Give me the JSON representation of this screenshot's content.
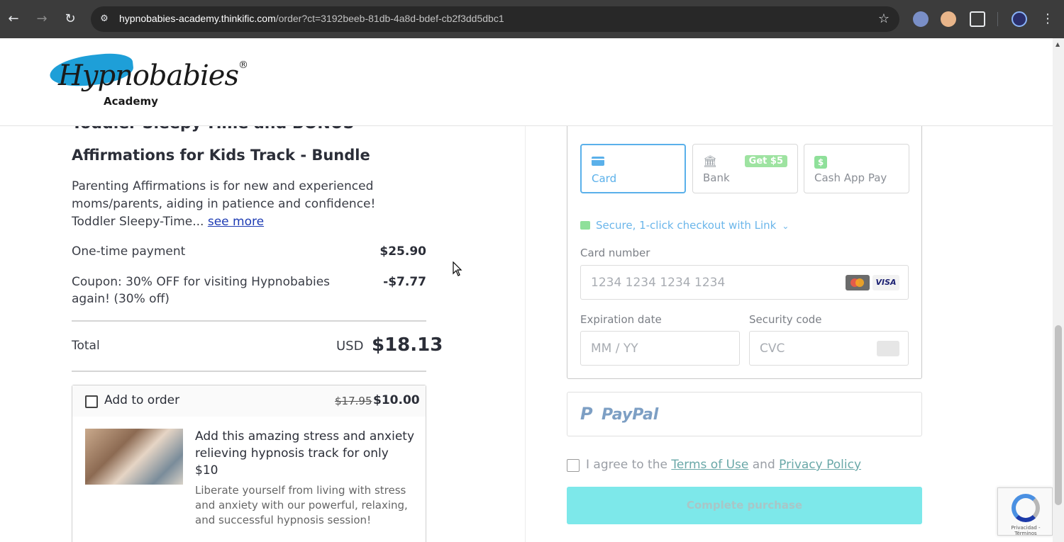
{
  "browser": {
    "url_host": "hypnobabies-academy.thinkific.com",
    "url_rest": "/order?ct=3192beeb-81db-4a8d-bdef-cb2f3dd5dbc1"
  },
  "header": {
    "logo_script": "Hypnobabies",
    "logo_reg": "®",
    "logo_sub": "Academy"
  },
  "product": {
    "title_line1": "Toddler Sleepy-Time and BONUS",
    "title_line2": "Affirmations for Kids Track - Bundle",
    "description": "Parenting Affirmations is for new and experienced moms/parents, aiding in patience and confidence! Toddler Sleepy-Time...",
    "see_more": "see more"
  },
  "summary": {
    "payment_label": "One-time payment",
    "payment_amount": "$25.90",
    "coupon_label": "Coupon: 30% OFF for visiting Hypnobabies again! (30% off)",
    "coupon_amount": "-$7.77",
    "total_label": "Total",
    "total_currency": "USD",
    "total_amount": "$18.13"
  },
  "upsell": {
    "label": "Add to order",
    "old_price": "$17.95",
    "new_price": "$10.00",
    "headline": "Add this amazing stress and anxiety relieving hypnosis track for only $10",
    "subtext": "Liberate yourself from living with stress and anxiety with our powerful, relaxing, and successful hypnosis session!"
  },
  "payment": {
    "tabs": [
      {
        "label": "Card",
        "icon": "card-icon"
      },
      {
        "label": "Bank",
        "icon": "bank-icon",
        "badge": "Get $5"
      },
      {
        "label": "Cash App Pay",
        "icon": "cash-app-icon"
      }
    ],
    "link_text": "Secure, 1-click checkout with Link",
    "card_number_label": "Card number",
    "card_number_placeholder": "1234 1234 1234 1234",
    "visa_text": "VISA",
    "expiry_label": "Expiration date",
    "expiry_placeholder": "MM / YY",
    "cvc_label": "Security code",
    "cvc_placeholder": "CVC",
    "paypal_p": "P",
    "paypal_text": "PayPal"
  },
  "agreement": {
    "prefix": "I agree to the",
    "terms": "Terms of Use",
    "and": "and",
    "privacy": "Privacy Policy"
  },
  "purchase_button": "Complete purchase",
  "recaptcha_text": "Privacidad - Términos",
  "colors": {
    "accent": "#5ab0ea",
    "purchase_button": "#7de8ea",
    "link_green": "#6aa8a8"
  }
}
